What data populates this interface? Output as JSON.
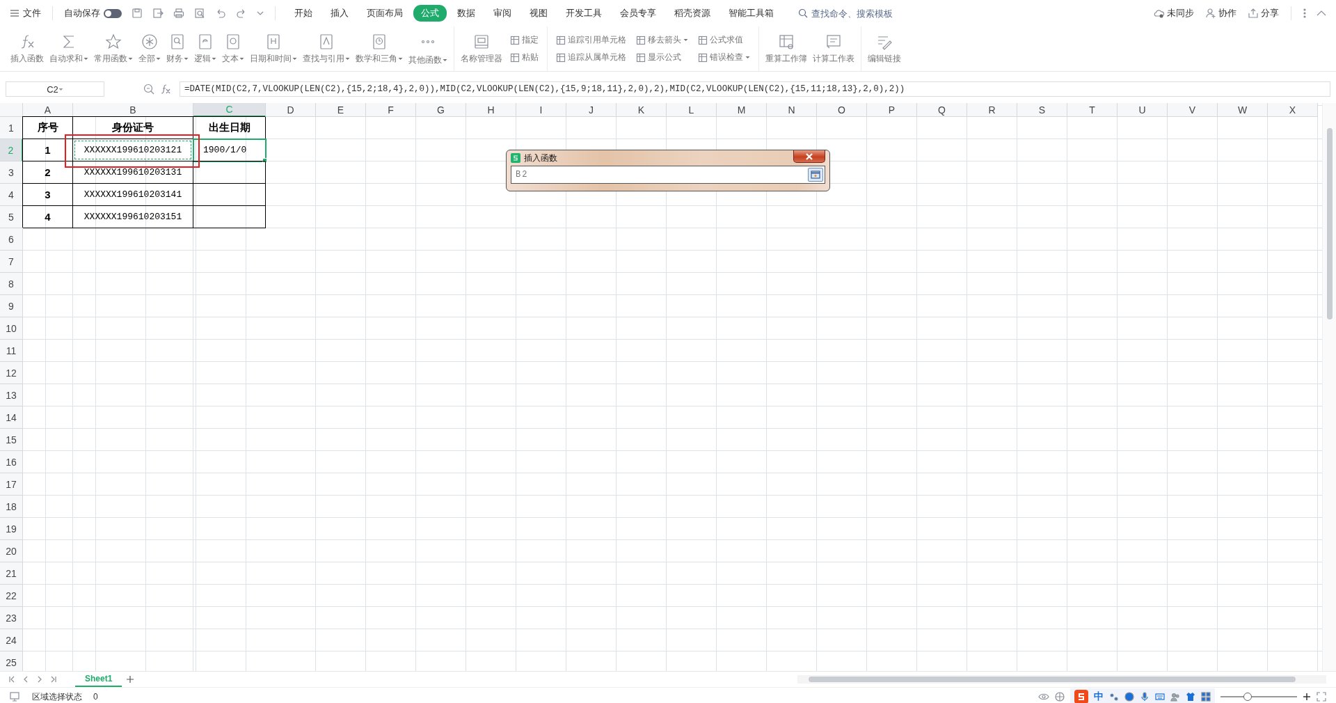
{
  "menu_bar": {
    "menu": "文件",
    "autosave": {
      "label": "自动保存",
      "on": false
    },
    "tabs": [
      {
        "label": "开始",
        "selected": false
      },
      {
        "label": "插入",
        "selected": false
      },
      {
        "label": "页面布局",
        "selected": false
      },
      {
        "label": "公式",
        "selected": true
      },
      {
        "label": "数据",
        "selected": false
      },
      {
        "label": "审阅",
        "selected": false
      },
      {
        "label": "视图",
        "selected": false
      },
      {
        "label": "开发工具",
        "selected": false
      },
      {
        "label": "会员专享",
        "selected": false
      },
      {
        "label": "稻壳资源",
        "selected": false
      },
      {
        "label": "智能工具箱",
        "selected": false
      }
    ],
    "search": {
      "placeholder": "查找命令、搜索模板"
    },
    "actions": [
      "未同步",
      "协作",
      "分享"
    ]
  },
  "ribbon": {
    "groups": [
      {
        "items": [
          {
            "kind": "large",
            "label": "插入函数",
            "dropdown": false
          },
          {
            "kind": "large",
            "label": "自动求和",
            "dropdown": true
          },
          {
            "kind": "large",
            "label": "常用函数",
            "dropdown": true
          },
          {
            "kind": "large",
            "label": "全部",
            "dropdown": true
          },
          {
            "kind": "large",
            "label": "财务",
            "dropdown": true
          },
          {
            "kind": "large",
            "label": "逻辑",
            "dropdown": true
          },
          {
            "kind": "large",
            "label": "文本",
            "dropdown": true
          },
          {
            "kind": "large",
            "label": "日期和时间",
            "dropdown": true
          },
          {
            "kind": "large",
            "label": "查找与引用",
            "dropdown": true
          },
          {
            "kind": "large",
            "label": "数学和三角",
            "dropdown": true
          },
          {
            "kind": "large",
            "label": "其他函数",
            "dropdown": true
          }
        ]
      },
      {
        "items": [
          {
            "kind": "large",
            "label": "名称管理器",
            "dropdown": false
          },
          {
            "kind": "stack",
            "items": [
              {
                "label": "指定",
                "dropdown": false
              },
              {
                "label": "粘贴",
                "dropdown": false
              }
            ]
          }
        ]
      },
      {
        "items": [
          {
            "kind": "stack",
            "items": [
              {
                "label": "追踪引用单元格",
                "dropdown": false
              },
              {
                "label": "追踪从属单元格",
                "dropdown": false
              }
            ]
          },
          {
            "kind": "stack",
            "items": [
              {
                "label": "移去箭头",
                "dropdown": true
              },
              {
                "label": "显示公式",
                "dropdown": false
              }
            ]
          },
          {
            "kind": "stack",
            "items": [
              {
                "label": "公式求值",
                "dropdown": false
              },
              {
                "label": "错误检查",
                "dropdown": true
              }
            ]
          }
        ]
      },
      {
        "items": [
          {
            "kind": "large",
            "label": "重算工作簿",
            "dropdown": false
          },
          {
            "kind": "large",
            "label": "计算工作表",
            "dropdown": false
          }
        ]
      },
      {
        "items": [
          {
            "kind": "large",
            "label": "编辑链接",
            "dropdown": false
          }
        ]
      }
    ]
  },
  "formula_bar": {
    "name_box": "C2",
    "formula": "=DATE(MID(C2,7,VLOOKUP(LEN(C2),{15,2;18,4},2,0)),MID(C2,VLOOKUP(LEN(C2),{15,9;18,11},2,0),2),MID(C2,VLOOKUP(LEN(C2),{15,11;18,13},2,0),2))"
  },
  "sheet": {
    "columns": [
      {
        "label": "A",
        "selected": false
      },
      {
        "label": "B",
        "selected": false
      },
      {
        "label": "C",
        "selected": true
      },
      {
        "label": "D",
        "selected": false
      },
      {
        "label": "E",
        "selected": false
      },
      {
        "label": "F",
        "selected": false
      },
      {
        "label": "G",
        "selected": false
      },
      {
        "label": "H",
        "selected": false
      },
      {
        "label": "I",
        "selected": false
      },
      {
        "label": "J",
        "selected": false
      },
      {
        "label": "K",
        "selected": false
      },
      {
        "label": "L",
        "selected": false
      },
      {
        "label": "M",
        "selected": false
      },
      {
        "label": "N",
        "selected": false
      },
      {
        "label": "O",
        "selected": false
      },
      {
        "label": "P",
        "selected": false
      },
      {
        "label": "Q",
        "selected": false
      },
      {
        "label": "R",
        "selected": false
      },
      {
        "label": "S",
        "selected": false
      },
      {
        "label": "T",
        "selected": false
      },
      {
        "label": "U",
        "selected": false
      },
      {
        "label": "V",
        "selected": false
      },
      {
        "label": "W",
        "selected": false
      },
      {
        "label": "X",
        "selected": false
      }
    ],
    "rows": [
      {
        "label": "1",
        "selected": false,
        "cells": [
          {
            "kind": "text",
            "text": "序号",
            "bold": true
          },
          {
            "kind": "text",
            "text": "身份证号",
            "bold": true
          },
          {
            "kind": "text",
            "text": "出生日期",
            "bold": true
          }
        ]
      },
      {
        "label": "2",
        "selected": true,
        "cells": [
          {
            "kind": "text",
            "text": "1",
            "bold": true
          },
          {
            "kind": "text",
            "text": "XXXXXX199610203121",
            "bold": false,
            "copy_marquee": true,
            "annotated": true
          },
          {
            "kind": "text",
            "text": "1900/1/0",
            "bold": false,
            "active": true
          }
        ]
      },
      {
        "label": "3",
        "selected": false,
        "cells": [
          {
            "kind": "text",
            "text": "2",
            "bold": true
          },
          {
            "kind": "text",
            "text": "XXXXXX199610203131",
            "bold": false
          },
          {
            "kind": "blank"
          }
        ]
      },
      {
        "label": "4",
        "selected": false,
        "cells": [
          {
            "kind": "text",
            "text": "3",
            "bold": true
          },
          {
            "kind": "text",
            "text": "XXXXXX199610203141",
            "bold": false
          },
          {
            "kind": "blank"
          }
        ]
      },
      {
        "label": "5",
        "selected": false,
        "cells": [
          {
            "kind": "text",
            "text": "4",
            "bold": true
          },
          {
            "kind": "text",
            "text": "XXXXXX199610203151",
            "bold": false
          },
          {
            "kind": "blank"
          }
        ]
      },
      {
        "label": "6",
        "selected": false
      },
      {
        "label": "7",
        "selected": false
      },
      {
        "label": "8",
        "selected": false
      },
      {
        "label": "9",
        "selected": false
      },
      {
        "label": "10",
        "selected": false
      },
      {
        "label": "11",
        "selected": false
      },
      {
        "label": "12",
        "selected": false
      },
      {
        "label": "13",
        "selected": false
      },
      {
        "label": "14",
        "selected": false
      },
      {
        "label": "15",
        "selected": false
      },
      {
        "label": "16",
        "selected": false
      },
      {
        "label": "17",
        "selected": false
      },
      {
        "label": "18",
        "selected": false
      },
      {
        "label": "19",
        "selected": false
      },
      {
        "label": "20",
        "selected": false
      },
      {
        "label": "21",
        "selected": false
      },
      {
        "label": "22",
        "selected": false
      },
      {
        "label": "23",
        "selected": false
      },
      {
        "label": "24",
        "selected": false
      },
      {
        "label": "25",
        "selected": false
      }
    ]
  },
  "dialog": {
    "title": "插入函数",
    "value": "B2"
  },
  "sheet_tabs": [
    {
      "label": "Sheet1",
      "selected": true
    }
  ],
  "status_bar": {
    "mode": "区域选择状态",
    "count": "0",
    "ime": {
      "label": "中"
    },
    "zoom": {
      "level": 0.35
    }
  }
}
